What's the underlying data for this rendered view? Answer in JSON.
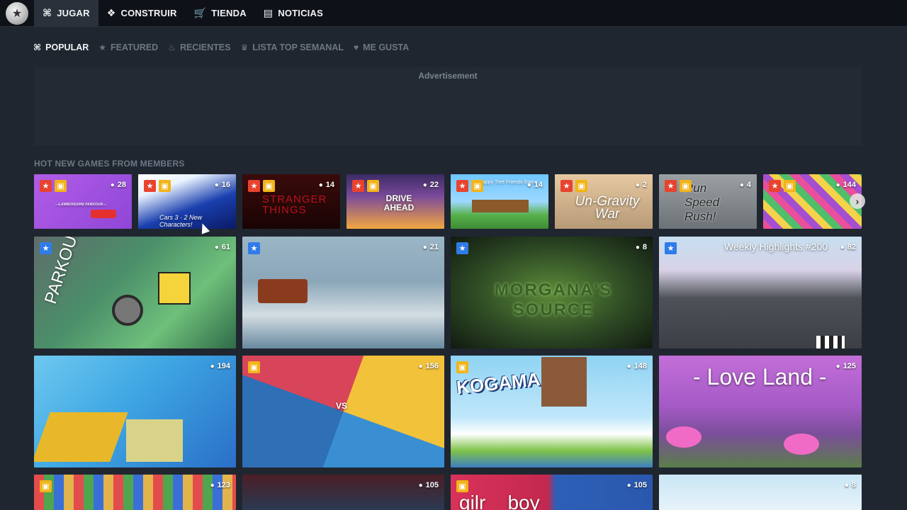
{
  "nav": {
    "items": [
      {
        "label": "JUGAR",
        "icon": "gamepad-icon",
        "glyph": "⌘"
      },
      {
        "label": "CONSTRUIR",
        "icon": "cubes-icon",
        "glyph": "❖"
      },
      {
        "label": "TIENDA",
        "icon": "cart-icon",
        "glyph": "🛒"
      },
      {
        "label": "NOTICIAS",
        "icon": "newspaper-icon",
        "glyph": "▤"
      }
    ]
  },
  "subtabs": [
    {
      "label": "POPULAR",
      "icon": "gamepad-icon",
      "glyph": "⌘"
    },
    {
      "label": "FEATURED",
      "icon": "star-icon",
      "glyph": "★"
    },
    {
      "label": "RECIENTES",
      "icon": "fire-icon",
      "glyph": "♨"
    },
    {
      "label": "LISTA TOP SEMANAL",
      "icon": "crown-icon",
      "glyph": "♛"
    },
    {
      "label": "ME GUSTA",
      "icon": "heart-icon",
      "glyph": "♥"
    }
  ],
  "advert": {
    "label": "Advertisement"
  },
  "section": {
    "title": "HOT NEW GAMES FROM MEMBERS"
  },
  "colors": {
    "accent_red": "#e8432f",
    "accent_blue": "#2f7be8",
    "accent_gold": "#f2b418",
    "topbar": "#0e1218",
    "page": "#202630"
  },
  "small_cards": [
    {
      "count": "28",
      "text": "---LAMBORGHINI PARKOUR---"
    },
    {
      "count": "16",
      "text": "Cars 3 · 2 New Characters!"
    },
    {
      "count": "14",
      "text": "STRANGER THINGS"
    },
    {
      "count": "22",
      "text": "DRIVE AHEAD"
    },
    {
      "count": "14",
      "text": "Happy Tree Friends Game"
    },
    {
      "count": "2",
      "text": "Un-Gravity War"
    },
    {
      "count": "4",
      "text": "Run Speed Rush!"
    },
    {
      "count": "144",
      "text": ""
    }
  ],
  "big_cards": [
    {
      "count": "61",
      "text": "PARKOUR"
    },
    {
      "count": "21",
      "text": ""
    },
    {
      "count": "8",
      "text": "MORGANA'S SOURCE"
    },
    {
      "count": "82",
      "text": "Weekly Highlights #200"
    },
    {
      "count": "194",
      "text": ""
    },
    {
      "count": "156",
      "text": "VS"
    },
    {
      "count": "148",
      "text": "KOGAMA"
    },
    {
      "count": "125",
      "text": "- Love Land -"
    },
    {
      "count": "123",
      "text": ""
    },
    {
      "count": "105",
      "text": ""
    },
    {
      "count": "105",
      "text": "gilr    boy"
    },
    {
      "count": "8",
      "text": ""
    }
  ]
}
